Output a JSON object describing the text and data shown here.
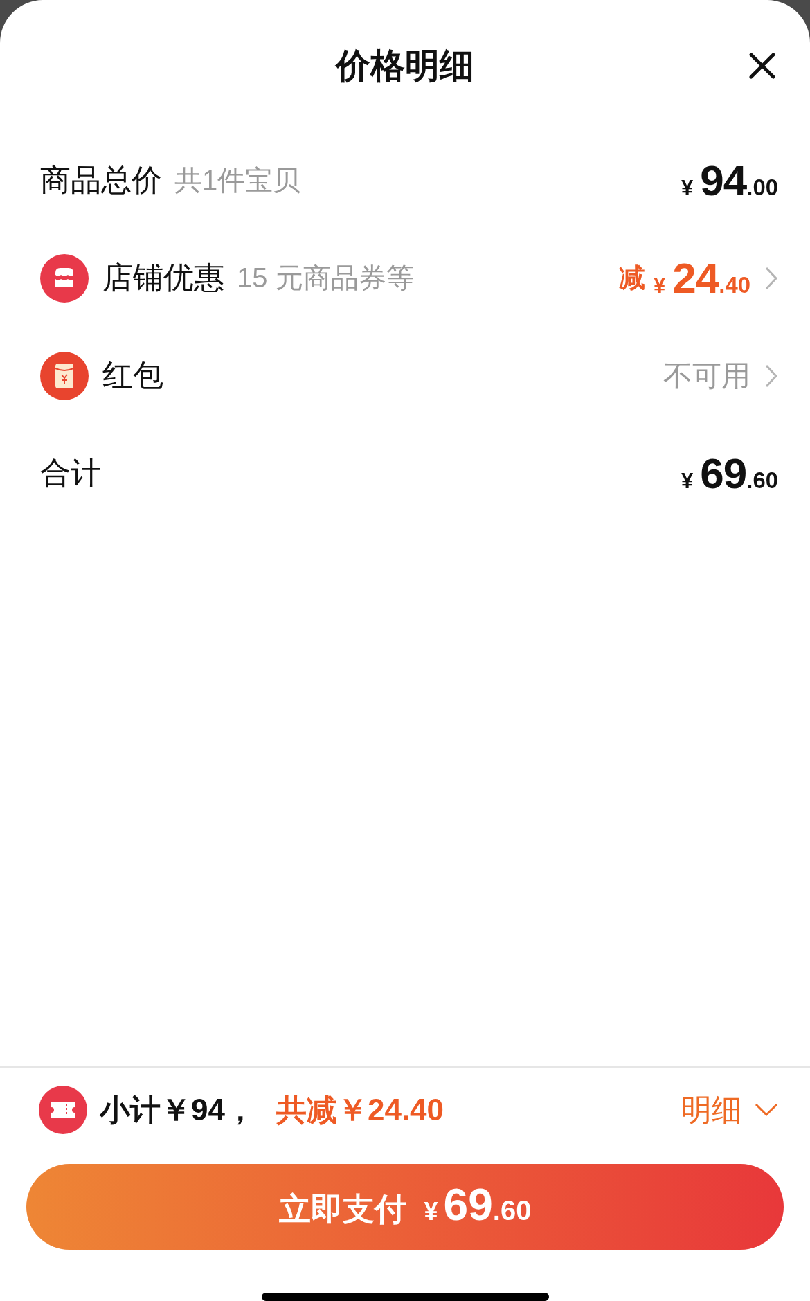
{
  "title": "价格明细",
  "rows": [
    {
      "kind": "total",
      "label": "商品总价",
      "note": "共1件宝贝",
      "price": {
        "currency": "¥",
        "integer": "94",
        "decimal": ".00"
      }
    },
    {
      "kind": "discount",
      "label": "店铺优惠",
      "note": "15 元商品券等",
      "prefix": "减",
      "price": {
        "currency": "¥",
        "integer": "24",
        "decimal": ".40"
      }
    },
    {
      "kind": "status",
      "label": "红包",
      "status": "不可用"
    },
    {
      "kind": "total",
      "label": "合计",
      "price": {
        "currency": "¥",
        "integer": "69",
        "decimal": ".60"
      }
    }
  ],
  "footer": {
    "subtotal": "小计￥94，",
    "reduction": "共减￥24.40",
    "detail": "明细"
  },
  "pay_button": {
    "label": "立即支付",
    "currency": "¥",
    "integer": "69",
    "decimal": ".60"
  }
}
